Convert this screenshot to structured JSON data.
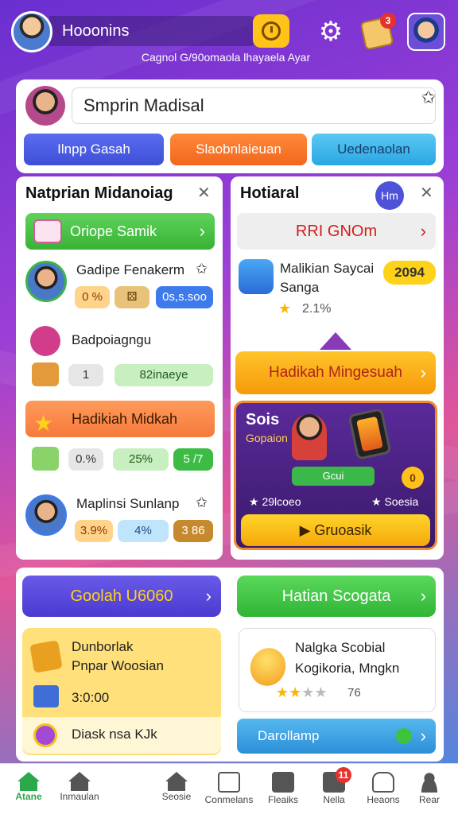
{
  "colors": {
    "accent": "#ffc31a",
    "primary_green": "#3cb84a",
    "primary_purple": "#4a3ad0",
    "alert_red": "#e5322d"
  },
  "header": {
    "username": "Hooonins",
    "ticker": "Cagnol G/90omaola lhayaela  Ayar",
    "notification_count": "3"
  },
  "search": {
    "value": "Smprin Madisal"
  },
  "top_buttons": {
    "blue": "Ilnpp Gasah",
    "orange": "Slaobnlaieuan",
    "cyan": "Uedenaolan"
  },
  "left_card": {
    "title": "Natprian Midanoiag",
    "green_bar": "Oriope Samik",
    "row1": {
      "name": "Gadipe Fenakerm",
      "chip1": "0 %",
      "chip2": "",
      "chip3": "0s,s.soo"
    },
    "row2": {
      "name": "Badpoiagngu",
      "chip1": "1",
      "chip2": "82inaeye"
    },
    "orange_bar": "Hadikiah Midkah",
    "row3": {
      "chip1": "0.%",
      "chip2": "25%",
      "chip3": "5 /7"
    },
    "row4": {
      "name": "Maplinsi Sunlanp",
      "chip1": "3.9%",
      "chip2": "4%",
      "chip3": "3 86"
    }
  },
  "right_card": {
    "title": "Hotiaral",
    "badge": "Hm",
    "grey_bar": "RRI GNOm",
    "item": {
      "name_line1": "Malikian Saycai",
      "name_line2": "Sanga",
      "pct": "2094",
      "rating": "2.1%"
    },
    "gold_btn": "Hadikah Mingesuah",
    "promo": {
      "title": "Sois",
      "subtitle": "Gopaion",
      "green_label": "Gcui",
      "circle": "0",
      "foot_left": "29lcoeo",
      "foot_right": "Soesia",
      "button": "Gruoasik"
    }
  },
  "bottom": {
    "purple_btn": "Goolah U6060",
    "green_btn": "Hatian Scogata",
    "yellow": {
      "line1": "Dunborlak",
      "line2": "Pnpar Woosian",
      "value": "3:0:00",
      "bottom": "Diask nsa KJk"
    },
    "white": {
      "line1": "Nalgka Scobial",
      "line2": "Kogikoria, Mngkn",
      "rating": "76"
    },
    "blue_bar": "Darollamp"
  },
  "nav": {
    "items": [
      "Atane",
      "Inmaulan",
      "Seosie",
      "Conmelans",
      "Fleaiks",
      "Nella",
      "Heaons",
      "Rear"
    ],
    "badge_item_2": "",
    "badge_item_6": "11"
  }
}
